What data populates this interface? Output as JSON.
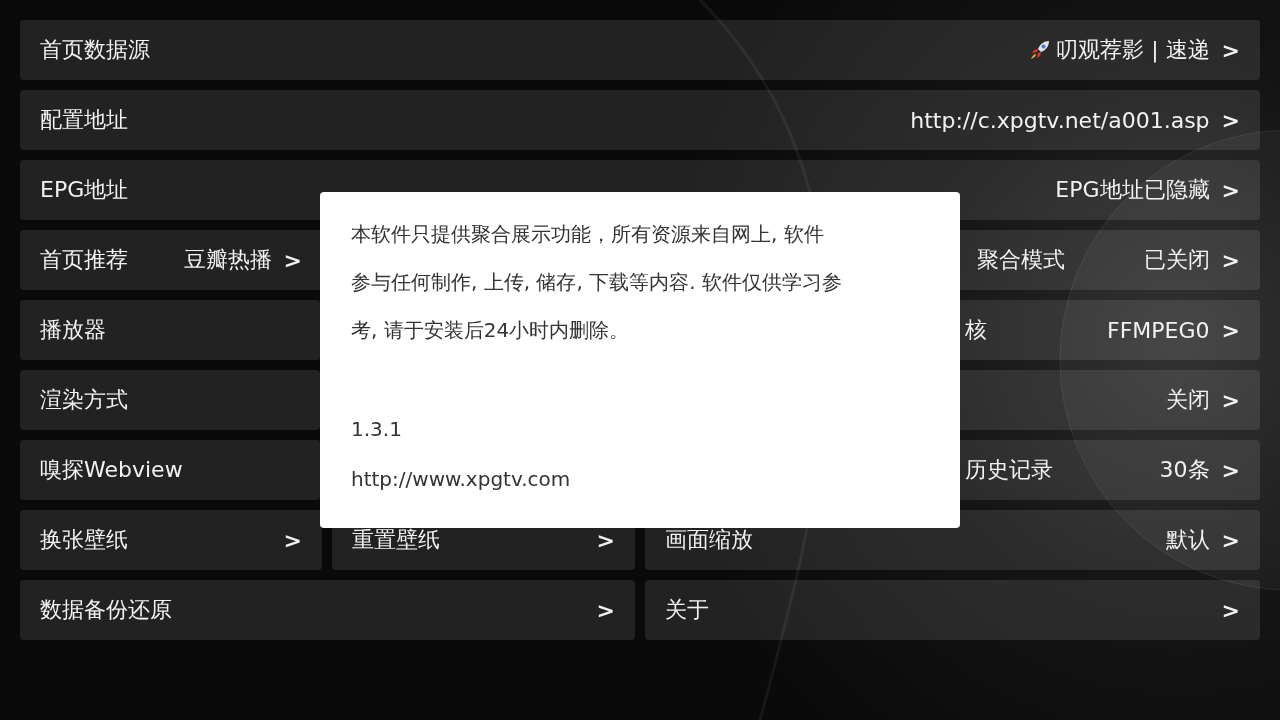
{
  "rows": [
    {
      "kind": "full",
      "cells": [
        {
          "label": "首页数据源",
          "leading_icon": true,
          "value": "叨观荐影 | 速递",
          "arrow": ">"
        }
      ]
    },
    {
      "kind": "full",
      "cells": [
        {
          "label": "配置地址",
          "value": "http://c.xpgtv.net/a001.asp",
          "arrow": ">"
        }
      ]
    },
    {
      "kind": "full",
      "cells": [
        {
          "label": "EPG地址",
          "value": "EPG地址已隐藏",
          "arrow": ">"
        }
      ]
    },
    {
      "kind": "outer",
      "cells": [
        {
          "label": "首页推荐",
          "value": "豆瓣热播",
          "arrow": ">"
        },
        {
          "label": "聚合模式",
          "value": "已关闭",
          "arrow": ">"
        }
      ]
    },
    {
      "kind": "covered",
      "cells": [
        {
          "label": "播放器"
        },
        {
          "label": "核",
          "value": "FFMPEG0",
          "arrow": ">"
        }
      ]
    },
    {
      "kind": "covered",
      "cells": [
        {
          "label": "渲染方式"
        },
        {
          "value": "关闭",
          "arrow": ">"
        }
      ]
    },
    {
      "kind": "covered",
      "cells": [
        {
          "label": "嗅探Webview"
        },
        {
          "label": "历史记录",
          "value": "30条",
          "arrow": ">"
        }
      ]
    },
    {
      "kind": "thirds",
      "cells": [
        {
          "label": "换张壁纸",
          "arrow": ">"
        },
        {
          "label": "重置壁纸",
          "arrow": ">"
        },
        {
          "label": "画面缩放",
          "value": "默认",
          "arrow": ">"
        }
      ]
    },
    {
      "kind": "halves",
      "cells": [
        {
          "label": "数据备份还原",
          "arrow": ">"
        },
        {
          "label": "关于",
          "arrow": ">"
        }
      ]
    }
  ],
  "dialog": {
    "notice_lines": [
      "本软件只提供聚合展示功能，所有资源来自网上, 软件",
      "参与任何制作, 上传, 储存, 下载等内容. 软件仅供学习参",
      "考, 请于安装后24小时内删除。"
    ],
    "version": "1.3.1",
    "website": "http://www.xpgtv.com"
  }
}
